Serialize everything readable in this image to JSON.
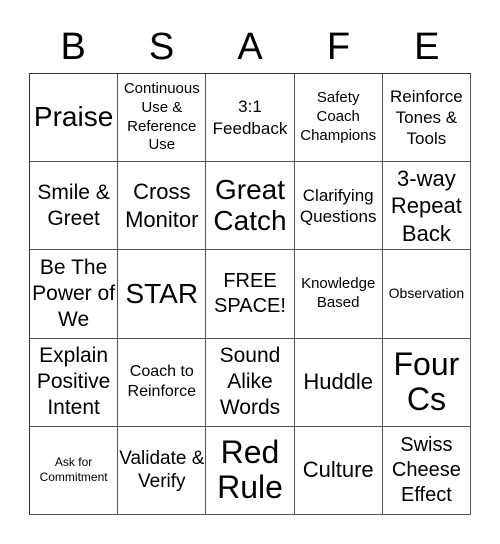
{
  "header": {
    "letters": [
      "B",
      "S",
      "A",
      "F",
      "E"
    ]
  },
  "board": {
    "rows": [
      [
        "Praise",
        "Continuous Use & Reference Use",
        "3:1 Feedback",
        "Safety Coach Champions",
        "Reinforce Tones & Tools"
      ],
      [
        "Smile & Greet",
        "Cross Monitor",
        "Great Catch",
        "Clarifying Questions",
        "3-way Repeat Back"
      ],
      [
        "Be The Power of We",
        "STAR",
        "FREE SPACE!",
        "Knowledge Based",
        "Observation"
      ],
      [
        "Explain Positive Intent",
        "Coach to Reinforce",
        "Sound Alike Words",
        "Huddle",
        "Four Cs"
      ],
      [
        "Ask for Commitment",
        "Validate & Verify",
        "Red Rule",
        "Culture",
        "Swiss Cheese Effect"
      ]
    ]
  }
}
